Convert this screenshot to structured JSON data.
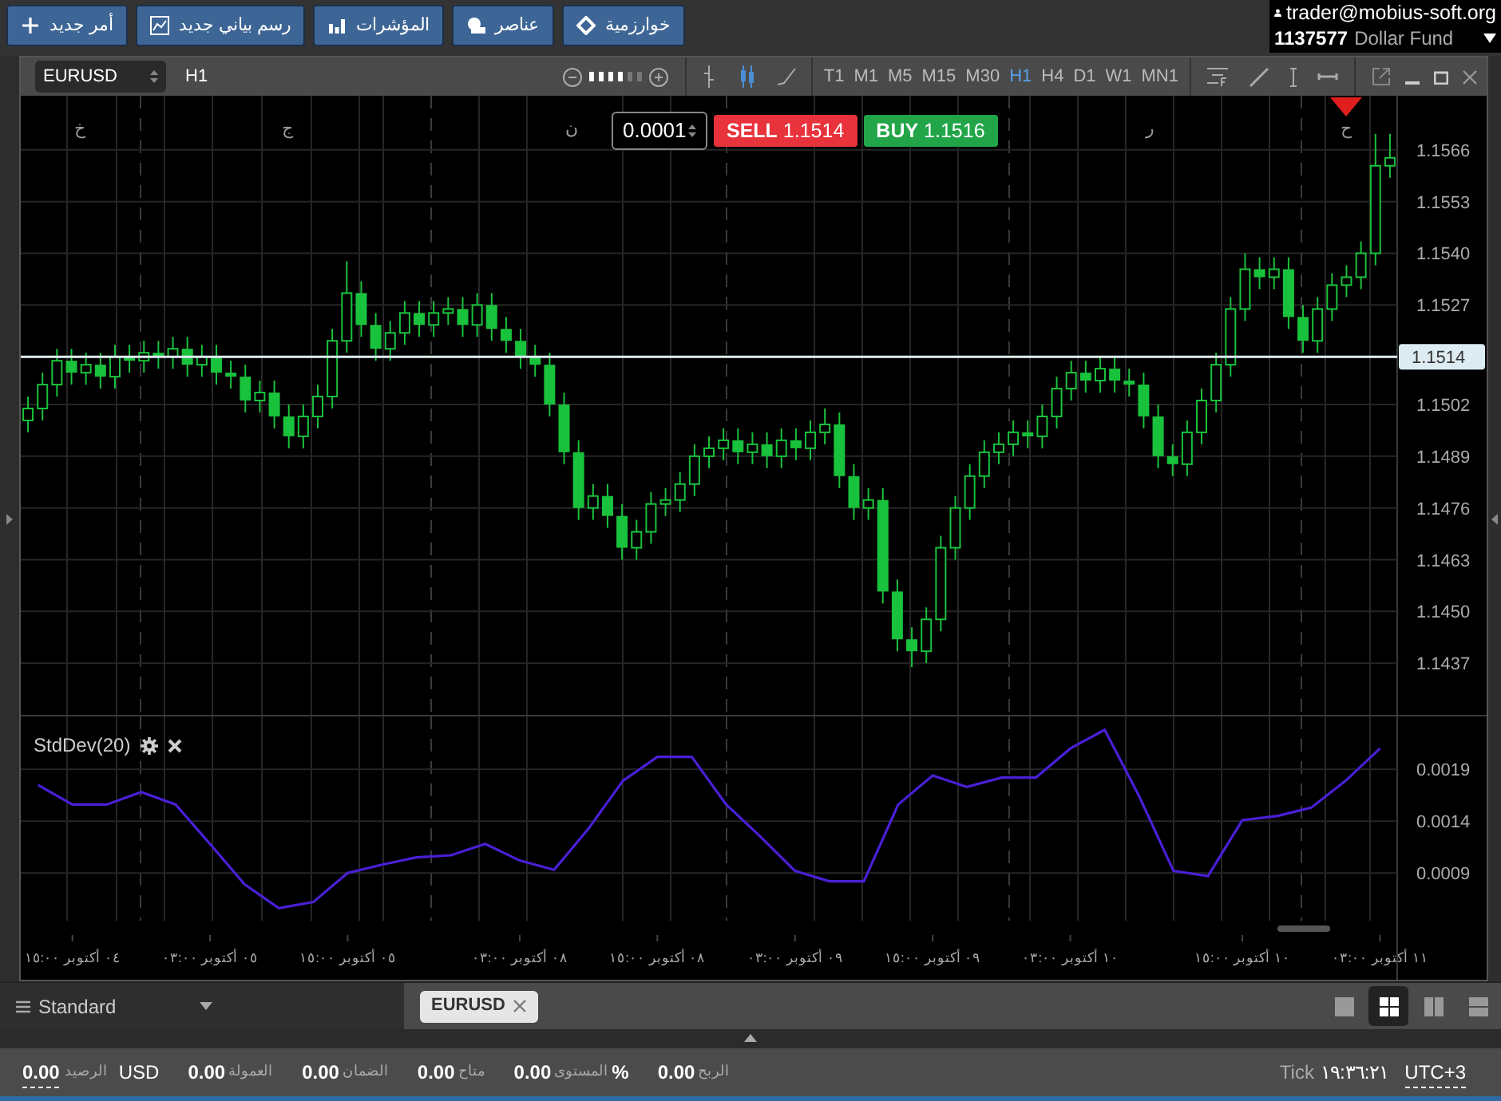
{
  "toolbar": [
    {
      "label": "خوارزمية",
      "kind": "diamond"
    },
    {
      "label": "عناصر",
      "kind": "shapes"
    },
    {
      "label": "المؤشرات",
      "kind": "bars"
    },
    {
      "label": "رسم بياني جديد",
      "kind": "chart"
    },
    {
      "label": "أمر جديد",
      "kind": "plus"
    }
  ],
  "account": {
    "email": "trader@mobius-soft.org",
    "number": "1137577",
    "name": "Dollar Fund"
  },
  "chart_window": {
    "symbol": "EURUSD",
    "timeframe": "H1",
    "step": "0.0001",
    "sell": {
      "label": "SELL",
      "price": "1.1514"
    },
    "buy": {
      "label": "BUY",
      "price": "1.1516"
    },
    "timeframes": [
      {
        "label": "MN1",
        "selected": false
      },
      {
        "label": "W1",
        "selected": false
      },
      {
        "label": "D1",
        "selected": false
      },
      {
        "label": "H4",
        "selected": false
      },
      {
        "label": "H1",
        "selected": true
      },
      {
        "label": "M30",
        "selected": false
      },
      {
        "label": "M15",
        "selected": false
      },
      {
        "label": "M5",
        "selected": false
      },
      {
        "label": "M1",
        "selected": false
      },
      {
        "label": "T1",
        "selected": false
      }
    ],
    "day_markers": [
      "ح",
      "ر",
      "ن",
      "ج",
      "خ"
    ],
    "price_chart": {
      "chart_data": {
        "type": "candlestick",
        "grid": true,
        "ylim": [
          1.14236,
          1.15796
        ],
        "yticks": [
          {
            "value": 1.1566,
            "label": "1.1566"
          },
          {
            "value": 1.1553,
            "label": "1.1553"
          },
          {
            "value": 1.154,
            "label": "1.1540"
          },
          {
            "value": 1.1527,
            "label": "1.1527"
          },
          {
            "value": 1.1502,
            "label": "1.1502"
          },
          {
            "value": 1.1489,
            "label": "1.1489"
          },
          {
            "value": 1.1476,
            "label": "1.1476"
          },
          {
            "value": 1.1463,
            "label": "1.1463"
          },
          {
            "value": 1.145,
            "label": "1.1450"
          },
          {
            "value": 1.1437,
            "label": "1.1437"
          }
        ],
        "ref_lines": [
          {
            "axis": "y",
            "value": 1.1514,
            "label": "1.1514",
            "color": "#e0eef2"
          }
        ],
        "categories": [
          null,
          null,
          null,
          null,
          null,
          null,
          null,
          null,
          null,
          null,
          null,
          null,
          null,
          null,
          null,
          null,
          null,
          null,
          null,
          null,
          null,
          null,
          null,
          null,
          null,
          null,
          null,
          null,
          null,
          null,
          null,
          null,
          null,
          null,
          null,
          null,
          null,
          null,
          null,
          null,
          null,
          null,
          null,
          null,
          null,
          null,
          null,
          null,
          null,
          null,
          null,
          null,
          null,
          null,
          null,
          null,
          null,
          null,
          null,
          null,
          null,
          null,
          null,
          null,
          null,
          null,
          null,
          null,
          null,
          null,
          null,
          null,
          null,
          null,
          null,
          null,
          null,
          null,
          null,
          null,
          null,
          null,
          null,
          null,
          null,
          null,
          null,
          null,
          null,
          null,
          null,
          null,
          null,
          null,
          null
        ],
        "ohlc": [
          [
            1.1498,
            1.1504,
            1.1495,
            1.1501
          ],
          [
            1.1501,
            1.151,
            1.1498,
            1.1507
          ],
          [
            1.1507,
            1.1516,
            1.1504,
            1.1513
          ],
          [
            1.1513,
            1.1516,
            1.1507,
            1.151
          ],
          [
            1.151,
            1.1515,
            1.1507,
            1.1512
          ],
          [
            1.1512,
            1.1515,
            1.1506,
            1.1509
          ],
          [
            1.1509,
            1.1517,
            1.1506,
            1.1514
          ],
          [
            1.1514,
            1.1517,
            1.151,
            1.1513
          ],
          [
            1.1513,
            1.1518,
            1.151,
            1.1515
          ],
          [
            1.1515,
            1.1518,
            1.1511,
            1.1514
          ],
          [
            1.1514,
            1.1519,
            1.1511,
            1.1516
          ],
          [
            1.1516,
            1.1519,
            1.1509,
            1.1512
          ],
          [
            1.1512,
            1.1517,
            1.1509,
            1.1514
          ],
          [
            1.1514,
            1.1517,
            1.1507,
            1.151
          ],
          [
            1.151,
            1.1513,
            1.1506,
            1.1509
          ],
          [
            1.1509,
            1.1512,
            1.15,
            1.1503
          ],
          [
            1.1503,
            1.1508,
            1.15,
            1.1505
          ],
          [
            1.1505,
            1.1508,
            1.1496,
            1.1499
          ],
          [
            1.1499,
            1.1502,
            1.1491,
            1.1494
          ],
          [
            1.1494,
            1.1502,
            1.1491,
            1.1499
          ],
          [
            1.1499,
            1.1507,
            1.1496,
            1.1504
          ],
          [
            1.1504,
            1.1521,
            1.1501,
            1.1518
          ],
          [
            1.1518,
            1.1538,
            1.1515,
            1.153
          ],
          [
            1.153,
            1.1533,
            1.1519,
            1.1522
          ],
          [
            1.1522,
            1.1525,
            1.1513,
            1.1516
          ],
          [
            1.1516,
            1.1523,
            1.1513,
            1.152
          ],
          [
            1.152,
            1.1528,
            1.1517,
            1.1525
          ],
          [
            1.1525,
            1.1528,
            1.1519,
            1.1522
          ],
          [
            1.1522,
            1.1528,
            1.1519,
            1.1525
          ],
          [
            1.1525,
            1.1529,
            1.1522,
            1.1526
          ],
          [
            1.1526,
            1.1529,
            1.1519,
            1.1522
          ],
          [
            1.1522,
            1.153,
            1.1519,
            1.1527
          ],
          [
            1.1527,
            1.153,
            1.1518,
            1.1521
          ],
          [
            1.1521,
            1.1524,
            1.1515,
            1.1518
          ],
          [
            1.1518,
            1.1521,
            1.1511,
            1.1514
          ],
          [
            1.1514,
            1.1517,
            1.1509,
            1.1512
          ],
          [
            1.1512,
            1.1515,
            1.1499,
            1.1502
          ],
          [
            1.1502,
            1.1505,
            1.1487,
            1.149
          ],
          [
            1.149,
            1.1493,
            1.1473,
            1.1476
          ],
          [
            1.1476,
            1.1482,
            1.1473,
            1.1479
          ],
          [
            1.1479,
            1.1482,
            1.1471,
            1.1474
          ],
          [
            1.1474,
            1.1477,
            1.1463,
            1.1466
          ],
          [
            1.1466,
            1.1473,
            1.1463,
            1.147
          ],
          [
            1.147,
            1.148,
            1.1467,
            1.1477
          ],
          [
            1.1477,
            1.1481,
            1.1474,
            1.1478
          ],
          [
            1.1478,
            1.1485,
            1.1475,
            1.1482
          ],
          [
            1.1482,
            1.1492,
            1.1479,
            1.1489
          ],
          [
            1.1489,
            1.1494,
            1.1486,
            1.1491
          ],
          [
            1.1491,
            1.1496,
            1.1488,
            1.1493
          ],
          [
            1.1493,
            1.1496,
            1.1487,
            1.149
          ],
          [
            1.149,
            1.1495,
            1.1487,
            1.1492
          ],
          [
            1.1492,
            1.1495,
            1.1486,
            1.1489
          ],
          [
            1.1489,
            1.1496,
            1.1486,
            1.1493
          ],
          [
            1.1493,
            1.1496,
            1.1488,
            1.1491
          ],
          [
            1.1491,
            1.1498,
            1.1488,
            1.1495
          ],
          [
            1.1495,
            1.1501,
            1.1492,
            1.1497
          ],
          [
            1.1497,
            1.15,
            1.1481,
            1.1484
          ],
          [
            1.1484,
            1.1487,
            1.1473,
            1.1476
          ],
          [
            1.1476,
            1.1481,
            1.1473,
            1.1478
          ],
          [
            1.1478,
            1.1481,
            1.1452,
            1.1455
          ],
          [
            1.1455,
            1.1458,
            1.144,
            1.1443
          ],
          [
            1.1443,
            1.1446,
            1.1436,
            1.144
          ],
          [
            1.144,
            1.1451,
            1.1437,
            1.1448
          ],
          [
            1.1448,
            1.1469,
            1.1445,
            1.1466
          ],
          [
            1.1466,
            1.1479,
            1.1463,
            1.1476
          ],
          [
            1.1476,
            1.1487,
            1.1473,
            1.1484
          ],
          [
            1.1484,
            1.1493,
            1.1481,
            1.149
          ],
          [
            1.149,
            1.1495,
            1.1487,
            1.1492
          ],
          [
            1.1492,
            1.1498,
            1.1489,
            1.1495
          ],
          [
            1.1495,
            1.1498,
            1.1491,
            1.1494
          ],
          [
            1.1494,
            1.1502,
            1.1491,
            1.1499
          ],
          [
            1.1499,
            1.1509,
            1.1496,
            1.1506
          ],
          [
            1.1506,
            1.1513,
            1.1503,
            1.151
          ],
          [
            1.151,
            1.1513,
            1.1505,
            1.1508
          ],
          [
            1.1508,
            1.1514,
            1.1505,
            1.1511
          ],
          [
            1.1511,
            1.1514,
            1.1505,
            1.1508
          ],
          [
            1.1508,
            1.1511,
            1.1504,
            1.1507
          ],
          [
            1.1507,
            1.151,
            1.1496,
            1.1499
          ],
          [
            1.1499,
            1.1502,
            1.1486,
            1.1489
          ],
          [
            1.1489,
            1.1492,
            1.1484,
            1.1487
          ],
          [
            1.1487,
            1.1498,
            1.1484,
            1.1495
          ],
          [
            1.1495,
            1.1506,
            1.1492,
            1.1503
          ],
          [
            1.1503,
            1.1515,
            1.15,
            1.1512
          ],
          [
            1.1512,
            1.1529,
            1.1509,
            1.1526
          ],
          [
            1.1526,
            1.154,
            1.1523,
            1.1536
          ],
          [
            1.1536,
            1.1539,
            1.1531,
            1.1534
          ],
          [
            1.1534,
            1.1539,
            1.1531,
            1.1536
          ],
          [
            1.1536,
            1.1539,
            1.1521,
            1.1524
          ],
          [
            1.1524,
            1.1527,
            1.1515,
            1.1518
          ],
          [
            1.1518,
            1.1529,
            1.1515,
            1.1526
          ],
          [
            1.1526,
            1.1535,
            1.1523,
            1.1532
          ],
          [
            1.1532,
            1.1537,
            1.1529,
            1.1534
          ],
          [
            1.1534,
            1.1543,
            1.1531,
            1.154
          ],
          [
            1.154,
            1.157,
            1.1537,
            1.1562
          ],
          [
            1.1562,
            1.157,
            1.1559,
            1.1564
          ]
        ]
      }
    },
    "indicator": {
      "chart_data": {
        "type": "line",
        "grid": true,
        "ylim": [
          -0.00013,
          0.00241
        ],
        "yticks": [
          {
            "value": 0.0019,
            "label": "0.0019"
          },
          {
            "value": 0.0014,
            "label": "0.0014"
          },
          {
            "value": 0.0009,
            "label": "0.0009"
          }
        ],
        "categories": [
          null,
          "٠٤ أكتوبر ١٥:٠٠",
          null,
          null,
          null,
          "٠٥ أكتوبر ٠٣:٠٠",
          null,
          null,
          null,
          "٠٥ أكتوبر ١٥:٠٠",
          null,
          null,
          null,
          null,
          "٠٨ أكتوبر ٠٣:٠٠",
          null,
          null,
          null,
          "٠٨ أكتوبر ١٥:٠٠",
          null,
          null,
          null,
          "٠٩ أكتوبر ٠٣:٠٠",
          null,
          null,
          null,
          "٠٩ أكتوبر ١٥:٠٠",
          null,
          null,
          null,
          "١٠ أكتوبر ٠٣:٠٠",
          null,
          null,
          null,
          null,
          "١٠ أكتوبر ١٥:٠٠",
          null,
          null,
          null,
          "١١ أكتوبر ٠٣:٠٠"
        ],
        "series": [
          {
            "name": "StdDev(20)",
            "color": "#4a1fd6",
            "values": [
              0.00175,
              0.00156,
              0.00156,
              0.00168,
              0.00156,
              0.00118,
              0.00079,
              0.00056,
              0.00062,
              0.0009,
              0.00098,
              0.00105,
              0.00107,
              0.00118,
              0.00102,
              0.00093,
              0.00133,
              0.00179,
              0.00202,
              0.00202,
              0.00156,
              0.00125,
              0.00092,
              0.00082,
              0.00082,
              0.00156,
              0.00184,
              0.00173,
              0.00182,
              0.00182,
              0.0021,
              0.00228,
              0.00164,
              0.00092,
              0.00087,
              0.00141,
              0.00145,
              0.00153,
              0.00179,
              0.0021
            ]
          }
        ]
      }
    }
  },
  "layout_name": "Standard",
  "chart_tabs": [
    {
      "label": "EURUSD"
    }
  ],
  "layouts": [
    {
      "kind": "single",
      "selected": false
    },
    {
      "kind": "grid",
      "selected": true
    },
    {
      "kind": "columns",
      "selected": false
    },
    {
      "kind": "rows",
      "selected": false
    }
  ],
  "status": {
    "balance": {
      "value": "0.00",
      "label": "الرصيد",
      "currency": "USD"
    },
    "items": [
      {
        "value": "0.00",
        "label": "الربح"
      },
      {
        "value": "0.00",
        "label": "المستوى",
        "suffix": "%"
      },
      {
        "value": "0.00",
        "label": "متاح"
      },
      {
        "value": "0.00",
        "label": "الضمان"
      },
      {
        "value": "0.00",
        "label": "العمولة"
      }
    ],
    "tick_label": "Tick",
    "tick_time": "١٩:٣٦:٢١",
    "timezone": "UTC+3"
  }
}
